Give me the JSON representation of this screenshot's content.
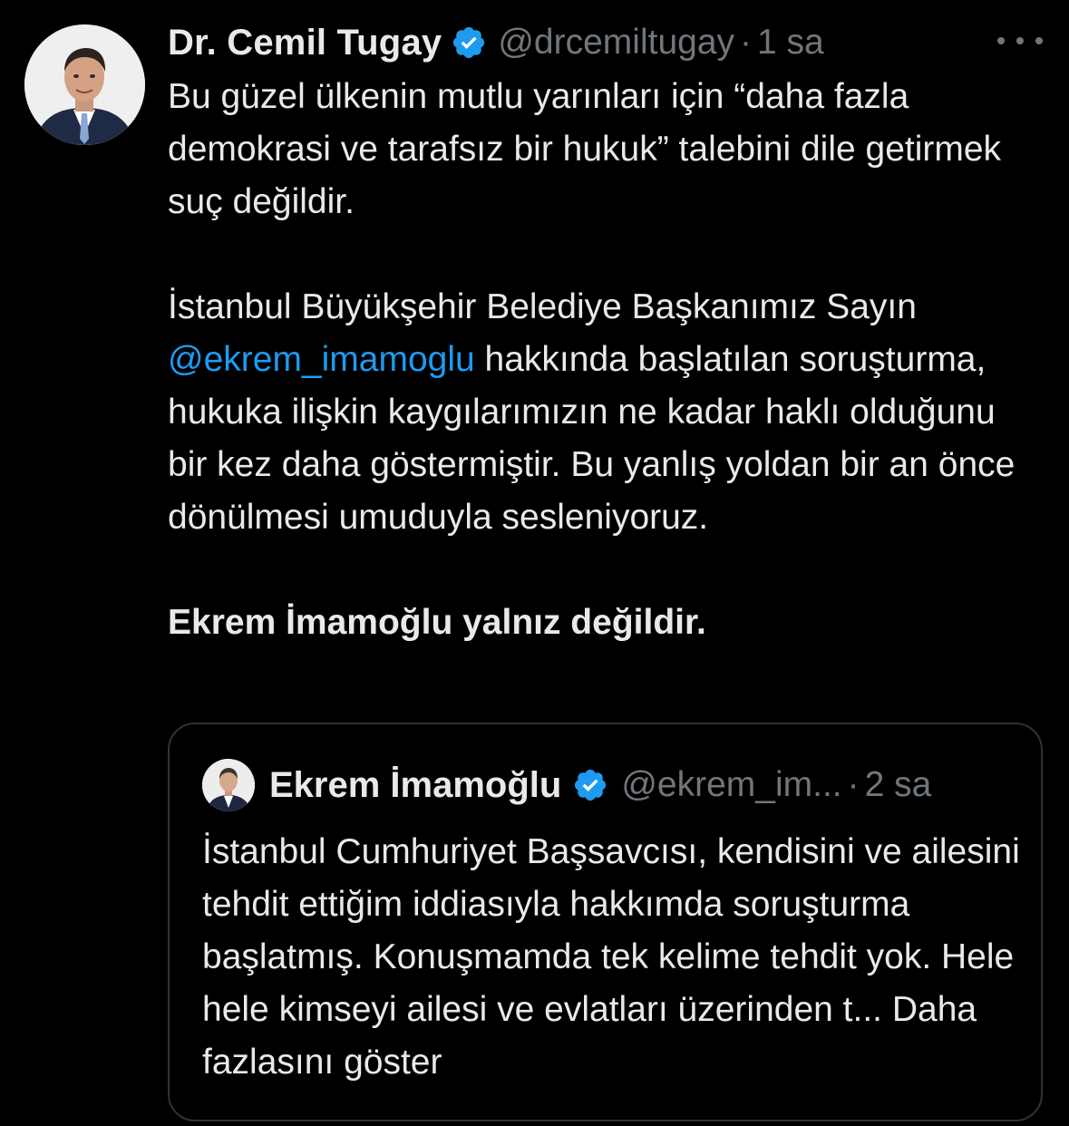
{
  "tweet": {
    "author_name": "Dr. Cemil Tugay",
    "author_handle": "@drcemiltugay",
    "separator": "·",
    "time": "1 sa",
    "paragraph1": "Bu güzel ülkenin mutlu yarınları için “daha fazla demokrasi ve tarafsız bir hukuk” talebini dile getirmek suç değildir.",
    "paragraph2_before": "İstanbul Büyükşehir Belediye Başkanımız Sayın ",
    "paragraph2_mention": "@ekrem_imamoglu",
    "paragraph2_after": " hakkında başlatılan soruşturma, hukuka ilişkin kaygılarımızın ne kadar haklı olduğunu bir kez daha göstermiştir. Bu yanlış yoldan bir an önce dönülmesi umuduyla sesleniyoruz.",
    "paragraph3": "Ekrem İmamoğlu yalnız değildir.",
    "colors": {
      "background": "#000000",
      "text": "#e7e9ea",
      "secondary": "#71767b",
      "link": "#1d9bf0",
      "verified": "#1d9bf0",
      "border": "#2f3336"
    }
  },
  "quoted": {
    "author_name": "Ekrem İmamoğlu",
    "author_handle": "@ekrem_im...",
    "separator": "·",
    "time": "2 sa",
    "text": "İstanbul Cumhuriyet Başsavcısı, kendisini ve ailesini tehdit ettiğim iddiasıyla hakkımda soruşturma başlatmış. Konuşmamda tek kelime tehdit yok. Hele hele kimseyi ailesi ve evlatları üzerinden t...",
    "show_more": "Daha fazlasını göster"
  },
  "icons": {
    "verified": "verified-badge-icon",
    "more": "more-options-icon"
  }
}
